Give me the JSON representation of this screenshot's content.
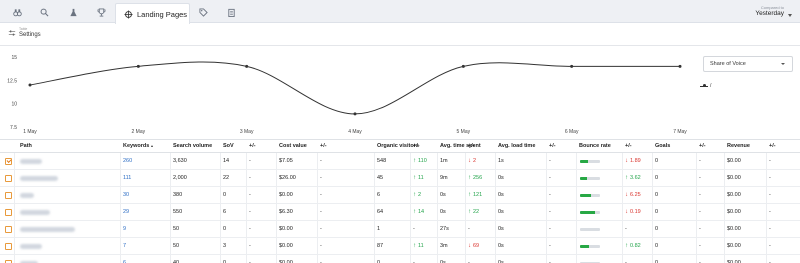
{
  "nav": {
    "icons": [
      "binoculars-icon",
      "search-icon",
      "flask-icon",
      "trophy-icon",
      "target-icon",
      "tag-icon",
      "clipboard-icon"
    ],
    "active_tab": "Landing Pages",
    "compared_label": "Compared to",
    "compared_value": "Yesterday"
  },
  "settings": {
    "small_label": "Table",
    "label": "Settings"
  },
  "chart_data": {
    "type": "line",
    "x": [
      "1 May",
      "2 May",
      "3 May",
      "4 May",
      "5 May",
      "6 May",
      "7 May"
    ],
    "series": [
      {
        "name": "/",
        "values": [
          12.0,
          14.0,
          14.0,
          8.9,
          14.0,
          14.0,
          14.0
        ]
      }
    ],
    "y_ticks": [
      "15",
      "12.5",
      "10",
      "7.5"
    ],
    "ylim": [
      7.5,
      15
    ],
    "grid": false,
    "legend": "right",
    "metric_select": "Share of Voice"
  },
  "table": {
    "columns": [
      "Path",
      "Keywords",
      "Search volume",
      "SoV",
      "+/-",
      "Cost value",
      "+/-",
      "Organic visitors",
      "+/-",
      "Avg. time spent",
      "+/-",
      "Avg. load time",
      "+/-",
      "Bounce rate",
      "+/-",
      "Goals",
      "+/-",
      "Revenue",
      "+/-"
    ],
    "rows": [
      {
        "checked": true,
        "keywords": "260",
        "search_volume": "3,630",
        "sov": "14",
        "sov_d": "-",
        "cost": "$7.05",
        "cost_d": "-",
        "visitors": "548",
        "visitors_d": "110",
        "visitors_dir": "up",
        "time": "1m",
        "time_d": "2",
        "time_dir": "down",
        "load": "1s",
        "load_d": "-",
        "bounce": 0.4,
        "bounce_d": "1.89",
        "bounce_dir": "down",
        "goals": "0",
        "goals_d": "-",
        "revenue": "$0.00",
        "revenue_d": "-"
      },
      {
        "checked": false,
        "keywords": "111",
        "search_volume": "2,000",
        "sov": "22",
        "sov_d": "-",
        "cost": "$26.00",
        "cost_d": "-",
        "visitors": "45",
        "visitors_d": "11",
        "visitors_dir": "up",
        "time": "9m",
        "time_d": "256",
        "time_dir": "up",
        "load": "0s",
        "load_d": "-",
        "bounce": 0.35,
        "bounce_d": "3.62",
        "bounce_dir": "up",
        "goals": "0",
        "goals_d": "-",
        "revenue": "$0.00",
        "revenue_d": "-"
      },
      {
        "checked": false,
        "keywords": "30",
        "search_volume": "380",
        "sov": "0",
        "sov_d": "-",
        "cost": "$0.00",
        "cost_d": "-",
        "visitors": "6",
        "visitors_d": "2",
        "visitors_dir": "up",
        "time": "0s",
        "time_d": "121",
        "time_dir": "up",
        "load": "0s",
        "load_d": "-",
        "bounce": 0.55,
        "bounce_d": "6.25",
        "bounce_dir": "down",
        "goals": "0",
        "goals_d": "-",
        "revenue": "$0.00",
        "revenue_d": "-"
      },
      {
        "checked": false,
        "keywords": "29",
        "search_volume": "550",
        "sov": "6",
        "sov_d": "-",
        "cost": "$6.30",
        "cost_d": "-",
        "visitors": "64",
        "visitors_d": "14",
        "visitors_dir": "up",
        "time": "0s",
        "time_d": "22",
        "time_dir": "up",
        "load": "0s",
        "load_d": "-",
        "bounce": 0.75,
        "bounce_d": "0.19",
        "bounce_dir": "down",
        "goals": "0",
        "goals_d": "-",
        "revenue": "$0.00",
        "revenue_d": "-"
      },
      {
        "checked": false,
        "keywords": "9",
        "search_volume": "50",
        "sov": "0",
        "sov_d": "-",
        "cost": "$0.00",
        "cost_d": "-",
        "visitors": "1",
        "visitors_d": "-",
        "visitors_dir": "",
        "time": "27s",
        "time_d": "-",
        "time_dir": "",
        "load": "0s",
        "load_d": "-",
        "bounce": 0.0,
        "bounce_d": "-",
        "bounce_dir": "",
        "goals": "0",
        "goals_d": "-",
        "revenue": "$0.00",
        "revenue_d": "-"
      },
      {
        "checked": false,
        "keywords": "7",
        "search_volume": "50",
        "sov": "3",
        "sov_d": "-",
        "cost": "$0.00",
        "cost_d": "-",
        "visitors": "87",
        "visitors_d": "11",
        "visitors_dir": "up",
        "time": "3m",
        "time_d": "69",
        "time_dir": "down",
        "load": "0s",
        "load_d": "-",
        "bounce": 0.45,
        "bounce_d": "0.82",
        "bounce_dir": "up",
        "goals": "0",
        "goals_d": "-",
        "revenue": "$0.00",
        "revenue_d": "-"
      },
      {
        "checked": false,
        "keywords": "6",
        "search_volume": "40",
        "sov": "0",
        "sov_d": "-",
        "cost": "$0.00",
        "cost_d": "-",
        "visitors": "0",
        "visitors_d": "-",
        "visitors_dir": "",
        "time": "0s",
        "time_d": "-",
        "time_dir": "",
        "load": "0s",
        "load_d": "-",
        "bounce": 0.0,
        "bounce_d": "-",
        "bounce_dir": "",
        "goals": "0",
        "goals_d": "-",
        "revenue": "$0.00",
        "revenue_d": "-"
      }
    ]
  },
  "colors": {
    "accent": "#2b6cc4",
    "up": "#22a34a",
    "down": "#d9322c",
    "checkbox": "#e89a3c",
    "bounce_fill": "#27a845"
  }
}
